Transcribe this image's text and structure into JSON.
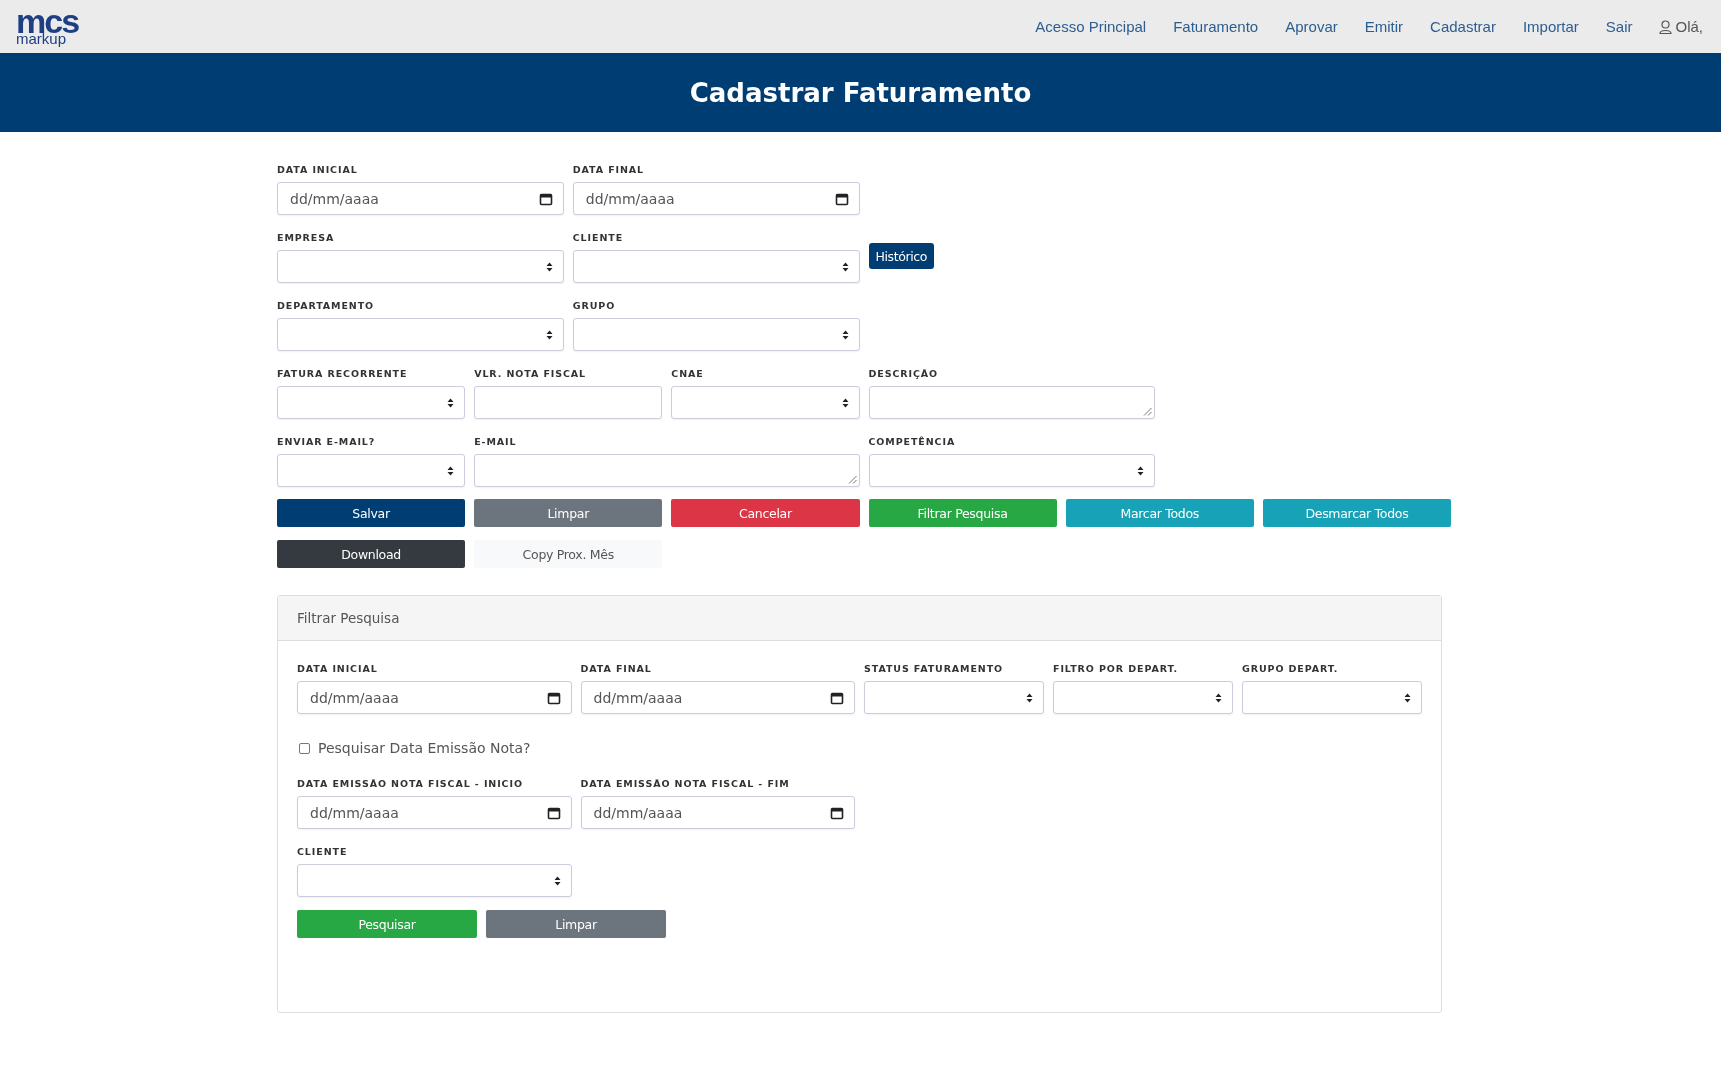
{
  "nav": {
    "logo": {
      "top": "mcs",
      "bottom": "markup"
    },
    "links": [
      {
        "label": "Acesso Principal"
      },
      {
        "label": "Faturamento"
      },
      {
        "label": "Aprovar"
      },
      {
        "label": "Emitir"
      },
      {
        "label": "Cadastrar"
      },
      {
        "label": "Importar"
      },
      {
        "label": "Sair"
      }
    ],
    "user": "Olá,"
  },
  "banner": {
    "title": "Cadastrar Faturamento"
  },
  "form": {
    "rows": [
      [
        {
          "kind": "date",
          "label": "DATA INICIAL",
          "placeholder": "dd/mm/aaaa"
        },
        {
          "kind": "date",
          "label": "DATA FINAL",
          "placeholder": "dd/mm/aaaa"
        }
      ],
      [
        {
          "kind": "select",
          "label": "EMPRESA"
        },
        {
          "kind": "select",
          "label": "CLIENTE"
        },
        {
          "kind": "button",
          "label": "Histórico"
        }
      ],
      [
        {
          "kind": "select",
          "label": "DEPARTAMENTO"
        },
        {
          "kind": "select",
          "label": "GRUPO"
        }
      ],
      [
        {
          "kind": "select",
          "label": "FATURA RECORRENTE"
        },
        {
          "kind": "text",
          "label": "VLR. NOTA FISCAL"
        },
        {
          "kind": "select",
          "label": "CNAE"
        },
        {
          "kind": "textarea",
          "label": "DESCRIÇÃO"
        }
      ],
      [
        {
          "kind": "select",
          "label": "ENVIAR E-MAIL?"
        },
        {
          "kind": "textarea",
          "label": "E-MAIL"
        },
        {
          "kind": "select",
          "label": "COMPETÊNCIA"
        }
      ]
    ],
    "buttons": [
      {
        "label": "Salvar",
        "kind": "primary"
      },
      {
        "label": "Limpar",
        "kind": "secondary"
      },
      {
        "label": "Cancelar",
        "kind": "danger"
      },
      {
        "label": "Filtrar Pesquisa",
        "kind": "success"
      },
      {
        "label": "Marcar Todos",
        "kind": "info"
      },
      {
        "label": "Desmarcar Todos",
        "kind": "info"
      },
      {
        "label": "Download",
        "kind": "dark"
      },
      {
        "label": "Copy Prox. Mês",
        "kind": "light"
      }
    ]
  },
  "filter_panel": {
    "title": "Filtrar Pesquisa",
    "row_1": [
      {
        "kind": "date",
        "label": "DATA INICIAL",
        "placeholder": "dd/mm/aaaa"
      },
      {
        "kind": "date",
        "label": "DATA FINAL",
        "placeholder": "dd/mm/aaaa"
      },
      {
        "kind": "select",
        "label": "STATUS FATURAMENTO"
      },
      {
        "kind": "select",
        "label": "FILTRO POR DEPART."
      },
      {
        "kind": "select",
        "label": "GRUPO DEPART."
      }
    ],
    "checkbox": {
      "label": "Pesquisar Data Emissão Nota?",
      "checked": false
    },
    "row_2": [
      {
        "kind": "date",
        "label": "DATA EMISSÃO NOTA FISCAL - INICIO",
        "placeholder": "dd/mm/aaaa"
      },
      {
        "kind": "date",
        "label": "DATA EMISSÃO NOTA FISCAL - FIM",
        "placeholder": "dd/mm/aaaa"
      }
    ],
    "row_3": [
      {
        "kind": "select",
        "label": "CLIENTE"
      }
    ],
    "buttons": [
      {
        "label": "Pesquisar",
        "kind": "success"
      },
      {
        "label": "Limpar",
        "kind": "secondary"
      }
    ]
  }
}
